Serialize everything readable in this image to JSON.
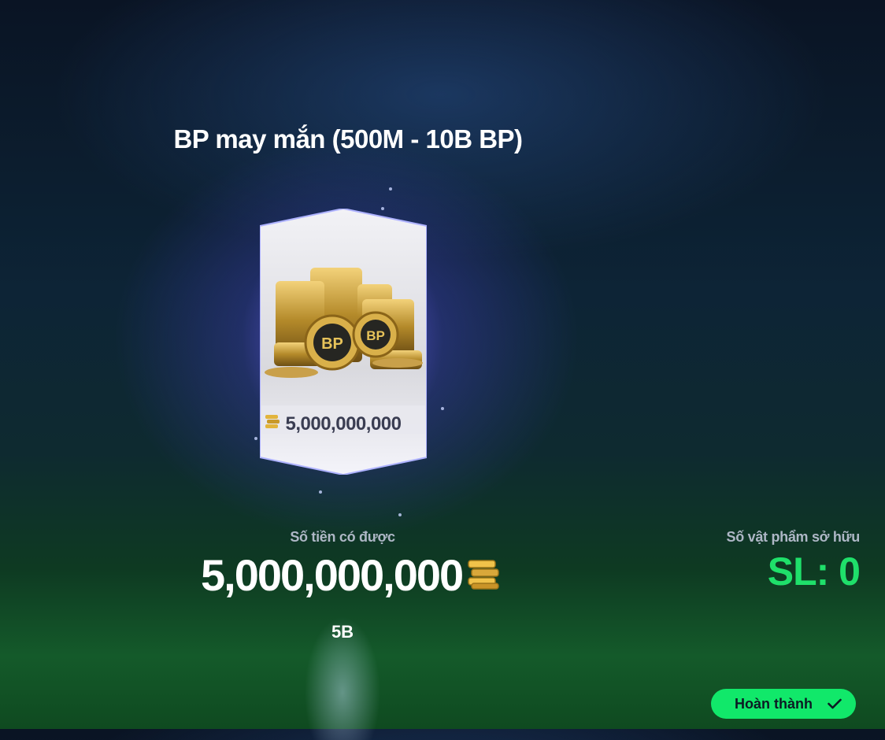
{
  "title": "BP may mắn (500M - 10B BP)",
  "card": {
    "value": "5,000,000,000",
    "coin_label": "BP",
    "icon": "coin-stack-icon"
  },
  "reward": {
    "label": "Số tiền có được",
    "amount": "5,000,000,000",
    "short": "5B",
    "icon": "coin-stack-icon"
  },
  "owned": {
    "label": "Số vật phẩm sở hữu",
    "value": "SL: 0"
  },
  "done_button": {
    "label": "Hoàn thành",
    "icon": "check-icon"
  },
  "colors": {
    "accent_green": "#11e86a",
    "count_green": "#1fe06a",
    "glow_purple": "#6a5cff"
  }
}
